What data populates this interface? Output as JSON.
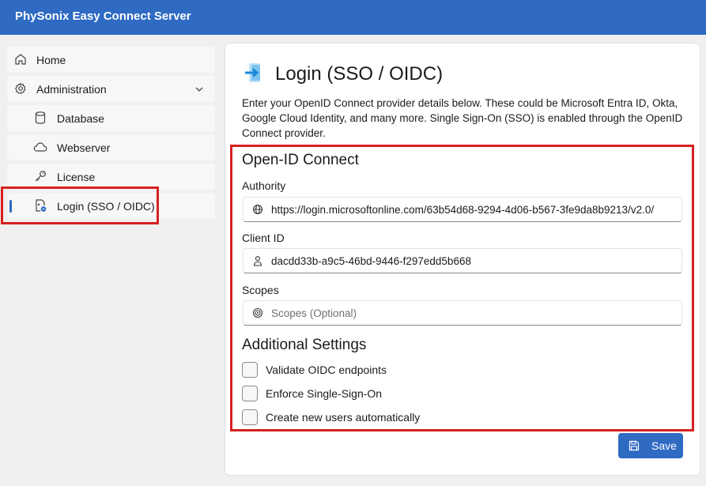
{
  "app": {
    "title": "PhySonix Easy Connect Server"
  },
  "sidebar": {
    "items": [
      {
        "label": "Home",
        "icon": "home-icon"
      },
      {
        "label": "Administration",
        "icon": "gear-icon",
        "expanded": true
      },
      {
        "label": "Database",
        "icon": "database-icon"
      },
      {
        "label": "Webserver",
        "icon": "cloud-icon"
      },
      {
        "label": "License",
        "icon": "key-icon"
      },
      {
        "label": "Login (SSO / OIDC)",
        "icon": "login-icon",
        "active": true
      }
    ]
  },
  "page": {
    "title": "Login (SSO / OIDC)",
    "intro": "Enter your OpenID Connect provider details below. These could be Microsoft Entra ID, Okta, Google Cloud Identity, and many more. Single Sign-On (SSO) is enabled through the OpenID Connect provider."
  },
  "form": {
    "section_oidc": "Open-ID Connect",
    "authority": {
      "label": "Authority",
      "value": "https://login.microsoftonline.com/63b54d68-9294-4d06-b567-3fe9da8b9213/v2.0/"
    },
    "client_id": {
      "label": "Client ID",
      "value": "dacdd33b-a9c5-46bd-9446-f297edd5b668"
    },
    "scopes": {
      "label": "Scopes",
      "value": "",
      "placeholder": "Scopes (Optional)"
    },
    "section_additional": "Additional Settings",
    "checkboxes": [
      {
        "label": "Validate OIDC endpoints",
        "checked": false
      },
      {
        "label": "Enforce Single-Sign-On",
        "checked": false
      },
      {
        "label": "Create new users automatically",
        "checked": false
      }
    ]
  },
  "actions": {
    "save_label": "Save"
  },
  "colors": {
    "accent": "#2f6ac3",
    "highlight": "#d62020"
  }
}
